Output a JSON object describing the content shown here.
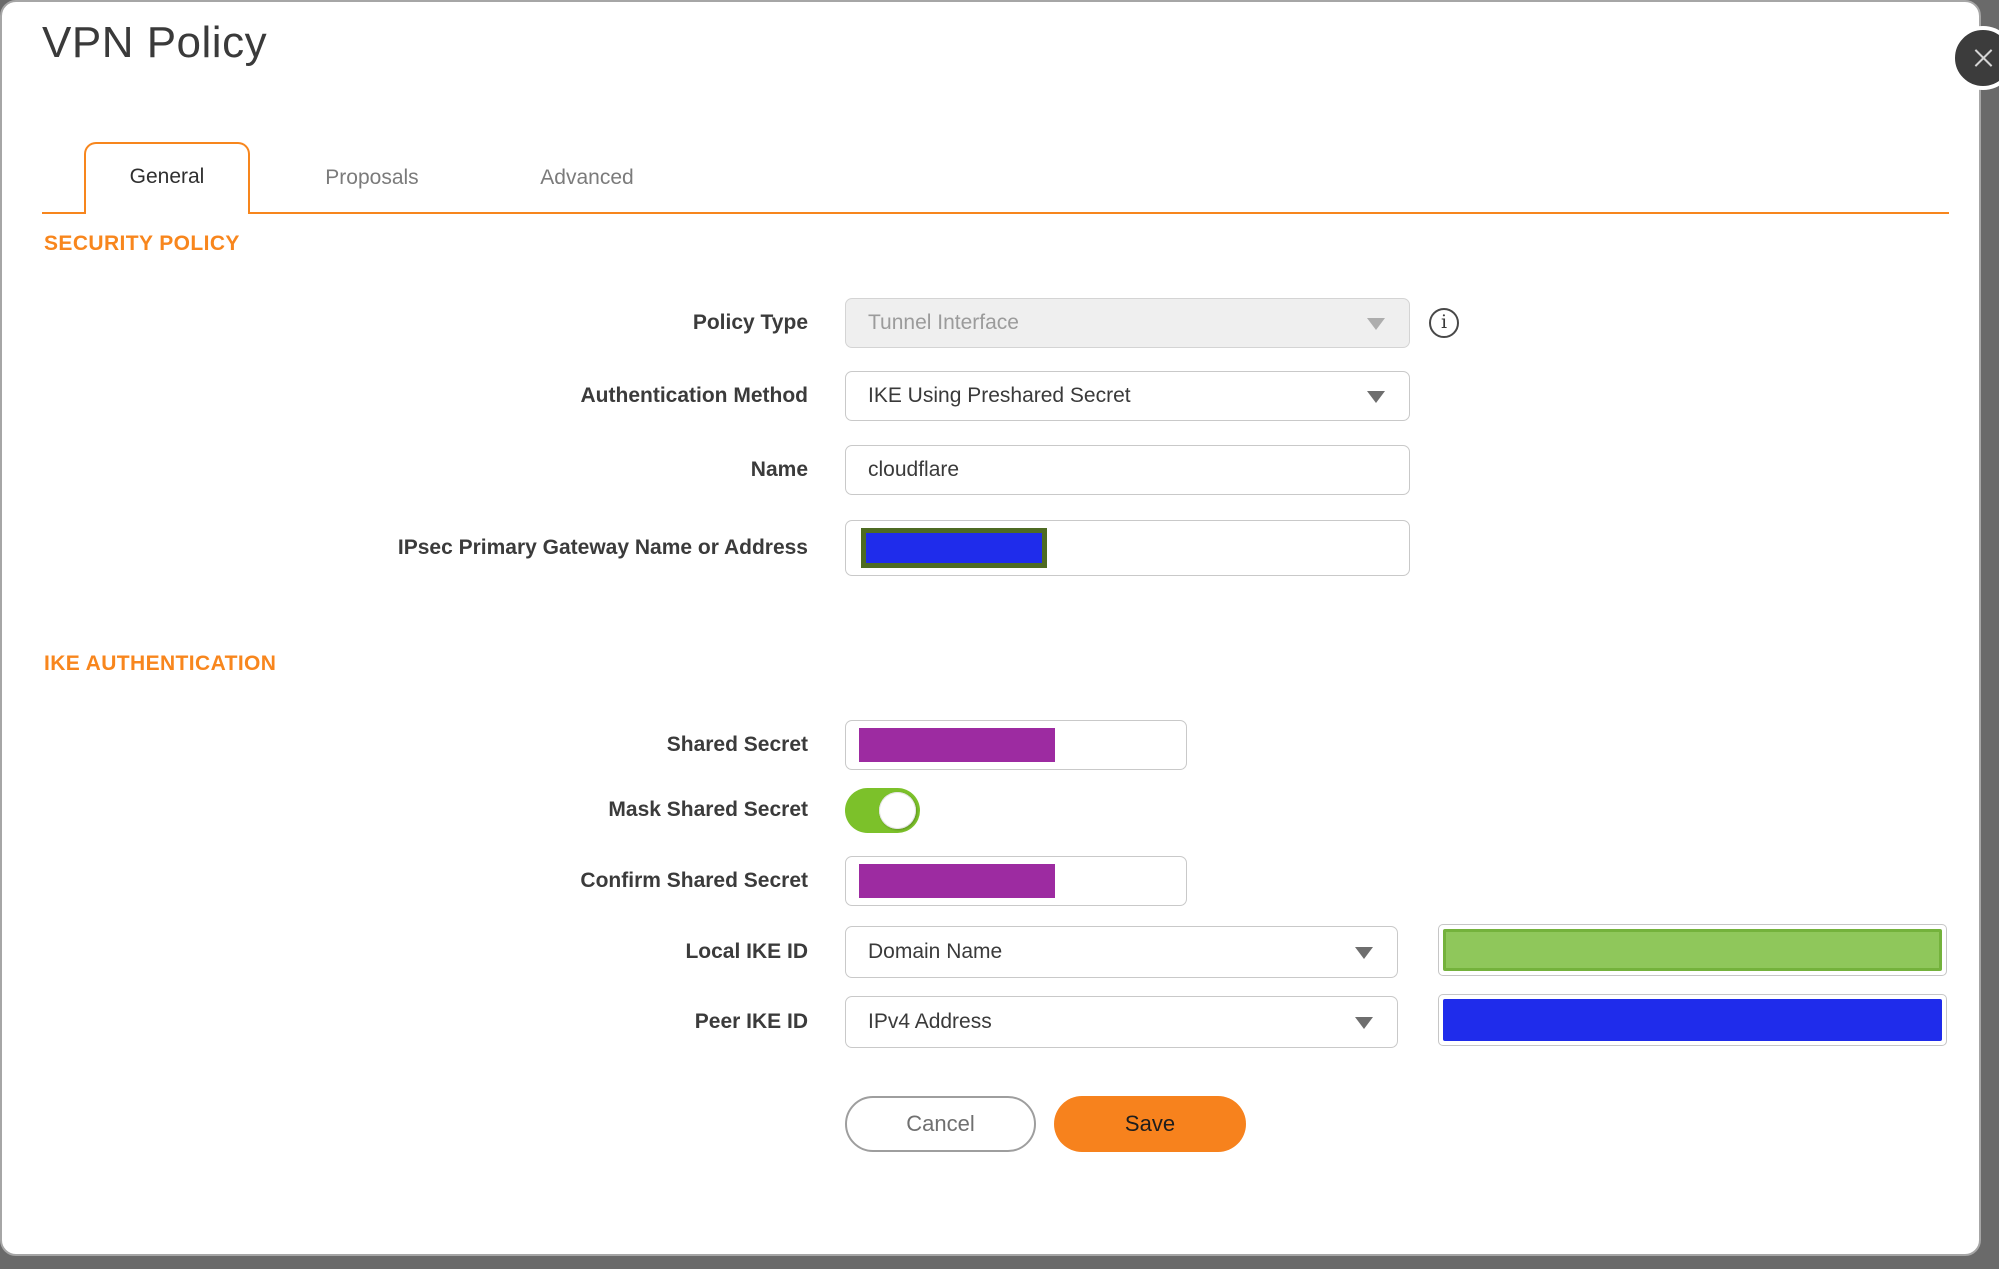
{
  "window": {
    "title": "VPN Policy"
  },
  "tabs": [
    {
      "label": "General",
      "active": true
    },
    {
      "label": "Proposals",
      "active": false
    },
    {
      "label": "Advanced",
      "active": false
    }
  ],
  "sections": {
    "security_policy": "SECURITY POLICY",
    "ike_authentication": "IKE AUTHENTICATION"
  },
  "fields": {
    "policy_type": {
      "label": "Policy Type",
      "value": "Tunnel Interface",
      "state": "disabled"
    },
    "auth_method": {
      "label": "Authentication Method",
      "value": "IKE Using Preshared Secret"
    },
    "name": {
      "label": "Name",
      "value": "cloudflare"
    },
    "gateway": {
      "label": "IPsec Primary Gateway Name or Address",
      "redaction": {
        "fill": "#1F2CEB",
        "border": "#4E6B22"
      }
    },
    "shared_secret": {
      "label": "Shared Secret",
      "redaction": {
        "fill": "#9D2BA1"
      }
    },
    "mask_shared_secret": {
      "label": "Mask Shared Secret",
      "state": "on"
    },
    "confirm_shared_secret": {
      "label": "Confirm Shared Secret",
      "redaction": {
        "fill": "#9D2BA1"
      }
    },
    "local_ike_id": {
      "label": "Local IKE ID",
      "value": "Domain Name",
      "id_redaction": {
        "fill": "#8FC75B",
        "border": "#74B23C"
      }
    },
    "peer_ike_id": {
      "label": "Peer IKE ID",
      "value": "IPv4 Address",
      "id_redaction": {
        "fill": "#1F2CEB"
      }
    }
  },
  "buttons": {
    "cancel": "Cancel",
    "save": "Save"
  },
  "icons": {
    "info_glyph": "i"
  },
  "colors": {
    "accent_orange": "#F7861D",
    "toggle_green": "#7CC12A",
    "backdrop_gray": "#6A6A6A",
    "close_button_bg": "#3C3C3C"
  }
}
